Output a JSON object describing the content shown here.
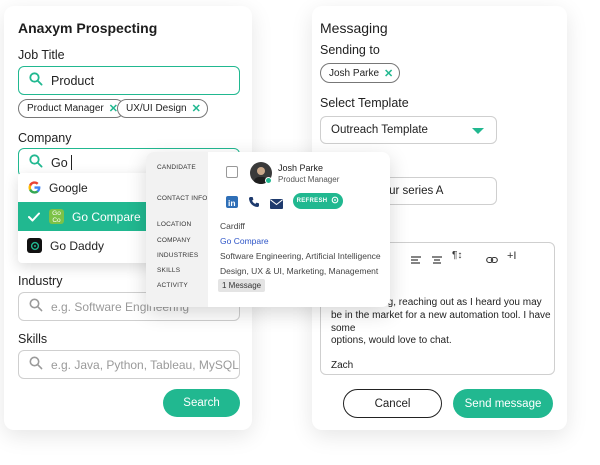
{
  "prospecting": {
    "title": "Anaxym Prospecting",
    "job_title": {
      "label": "Job Title",
      "value": "Product",
      "tags": [
        "Product Manager",
        "UX/UI Design"
      ]
    },
    "company": {
      "label": "Company",
      "value": "Go",
      "suggestions": [
        "Google",
        "Go Compare",
        "Go Daddy"
      ],
      "selected": "Go Compare"
    },
    "industry": {
      "label": "Industry",
      "placeholder": "e.g. Software Engineering"
    },
    "skills": {
      "label": "Skills",
      "placeholder": "e.g. Java, Python, Tableau, MySQL"
    },
    "search_label": "Search"
  },
  "messaging": {
    "title": "Messaging",
    "sending_to_label": "Sending to",
    "recipient": "Josh Parke",
    "select_template_label": "Select Template",
    "template": "Outreach Template",
    "subject_visible": "de your series A",
    "body_lines": [
      "necting, reaching out as I heard you may",
      "be in the market for a new automation tool. I have some",
      "options, would love to chat."
    ],
    "signature": "Zach",
    "cancel_label": "Cancel",
    "send_label": "Send message"
  },
  "contact_card": {
    "labels": {
      "candidate": "CANDIDATE",
      "contact_info": "CONTACT INFO",
      "location": "LOCATION",
      "company": "COMPANY",
      "industries": "INDUSTRIES",
      "skills": "SKILLS",
      "activity": "ACTIVITY"
    },
    "name": "Josh Parke",
    "role": "Product Manager",
    "refresh_label": "REFRESH",
    "location": "Cardiff",
    "company": "Go Compare",
    "industries": "Software Engineering, Artificial Intelligence",
    "skills": "Design, UX & UI, Marketing, Management",
    "activity": "1 Message"
  },
  "colors": {
    "accent": "#21b890",
    "link": "#2f56c8"
  },
  "icons": [
    "search-icon",
    "close-icon",
    "check-icon",
    "chevron-down-icon",
    "linkedin-icon",
    "phone-icon",
    "mail-icon",
    "refresh-icon"
  ]
}
